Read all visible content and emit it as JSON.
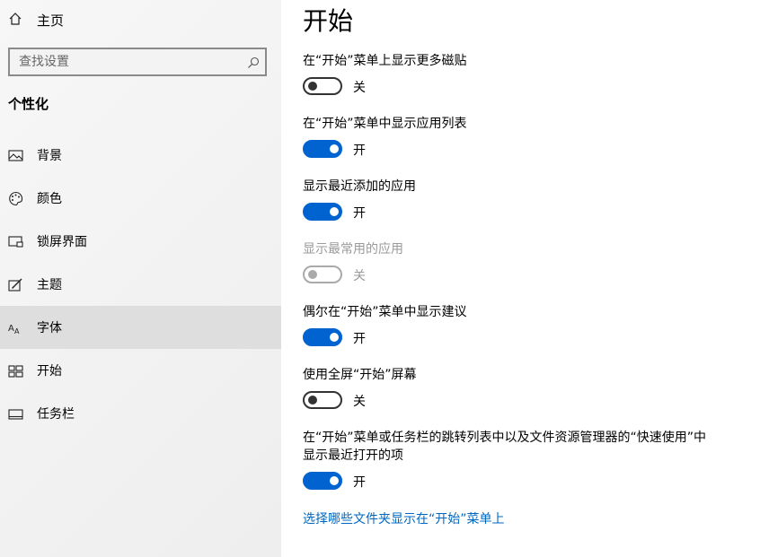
{
  "sidebar": {
    "home_label": "主页",
    "search_placeholder": "查找设置",
    "section_title": "个性化",
    "items": [
      {
        "label": "背景",
        "icon": "picture-icon"
      },
      {
        "label": "颜色",
        "icon": "palette-icon"
      },
      {
        "label": "锁屏界面",
        "icon": "lockscreen-icon"
      },
      {
        "label": "主题",
        "icon": "theme-brush-icon"
      },
      {
        "label": "字体",
        "icon": "font-icon",
        "selected": true
      },
      {
        "label": "开始",
        "icon": "start-tiles-icon"
      },
      {
        "label": "任务栏",
        "icon": "taskbar-icon"
      }
    ]
  },
  "main": {
    "title": "开始",
    "settings": [
      {
        "title": "在“开始”菜单上显示更多磁贴",
        "state": "关",
        "on": false,
        "disabled": false
      },
      {
        "title": "在“开始”菜单中显示应用列表",
        "state": "开",
        "on": true,
        "disabled": false
      },
      {
        "title": "显示最近添加的应用",
        "state": "开",
        "on": true,
        "disabled": false
      },
      {
        "title": "显示最常用的应用",
        "state": "关",
        "on": false,
        "disabled": true
      },
      {
        "title": "偶尔在“开始”菜单中显示建议",
        "state": "开",
        "on": true,
        "disabled": false
      },
      {
        "title": "使用全屏“开始”屏幕",
        "state": "关",
        "on": false,
        "disabled": false
      },
      {
        "title": "在“开始”菜单或任务栏的跳转列表中以及文件资源管理器的“快速使用”中显示最近打开的项",
        "state": "开",
        "on": true,
        "disabled": false
      }
    ],
    "link_text": "选择哪些文件夹显示在“开始”菜单上"
  },
  "colors": {
    "accent": "#0063d0",
    "link": "#0067c0",
    "selected_bg": "#dedede"
  }
}
